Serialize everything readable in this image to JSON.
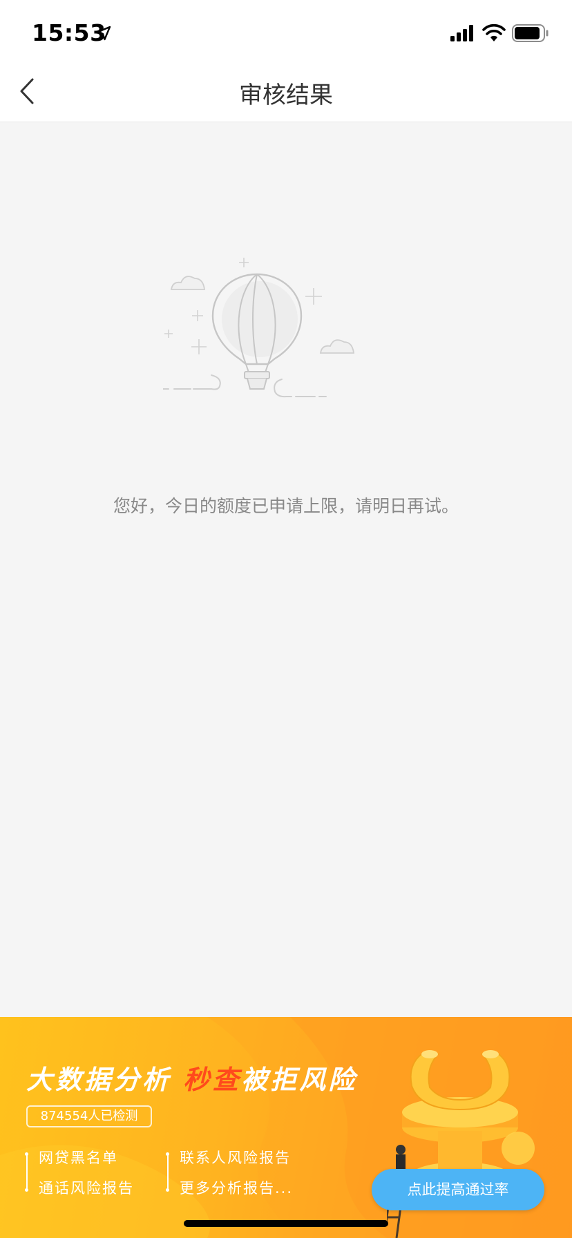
{
  "status_bar": {
    "time": "15:53",
    "icons": [
      "location-arrow-icon",
      "cellular-signal-icon",
      "wifi-icon",
      "battery-icon"
    ]
  },
  "nav": {
    "title": "审核结果",
    "back_icon": "chevron-left-icon"
  },
  "content": {
    "illustration": "empty-state-hot-air-balloon",
    "message": "您好，今日的额度已申请上限，请明日再试。"
  },
  "banner": {
    "headline_part1": "大数据分析",
    "headline_highlight": "秒查",
    "headline_part2": "被拒风险",
    "count_badge": "874554人已检测",
    "features_col1": [
      "网贷黑名单",
      "通话风险报告"
    ],
    "features_col2": [
      "联系人风险报告",
      "更多分析报告..."
    ],
    "cta_label": "点此提高通过率",
    "colors": {
      "background": "#ffb320",
      "highlight": "#ff4a1c",
      "cta": "#4db4f5"
    }
  }
}
